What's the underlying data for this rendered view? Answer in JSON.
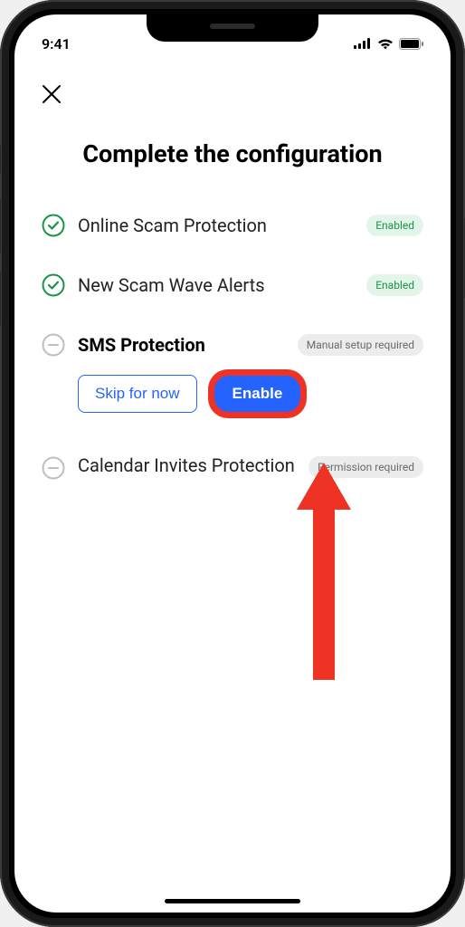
{
  "status_bar": {
    "time": "9:41"
  },
  "page": {
    "title": "Complete the configuration"
  },
  "items": [
    {
      "label": "Online Scam Protection",
      "badge": "Enabled"
    },
    {
      "label": "New Scam Wave Alerts",
      "badge": "Enabled"
    },
    {
      "label": "SMS Protection",
      "badge": "Manual setup required",
      "skip_label": "Skip for now",
      "enable_label": "Enable"
    },
    {
      "label": "Calendar Invites Protection",
      "badge": "Permission required"
    }
  ]
}
